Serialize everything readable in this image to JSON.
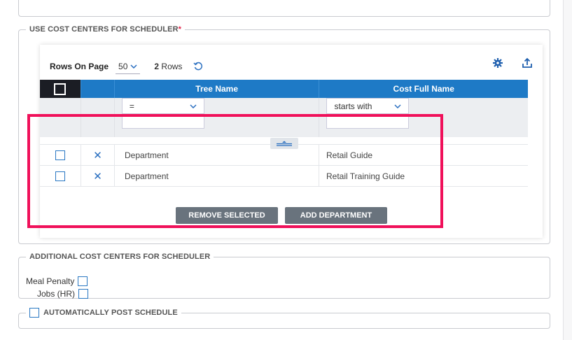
{
  "section_cost_centers": {
    "legend": "USE COST CENTERS FOR SCHEDULER",
    "required_mark": "*"
  },
  "toolbar": {
    "rows_on_page_label": "Rows On Page",
    "rows_on_page_value": "50",
    "rows_count_number": "2",
    "rows_count_text": "Rows"
  },
  "grid": {
    "columns": [
      "Tree Name",
      "Cost Full Name"
    ],
    "filters": {
      "tree_operator": "=",
      "cost_operator": "starts with"
    },
    "rows": [
      {
        "tree_name": "Department",
        "cost_full_name": "Retail Guide"
      },
      {
        "tree_name": "Department",
        "cost_full_name": "Retail Training Guide"
      }
    ]
  },
  "actions": {
    "remove_selected": "REMOVE SELECTED",
    "add_department": "ADD DEPARTMENT"
  },
  "section_additional": {
    "legend": "ADDITIONAL COST CENTERS FOR SCHEDULER",
    "options": [
      "Meal Penalty",
      "Jobs (HR)"
    ]
  },
  "section_auto_post": {
    "legend": "AUTOMATICALLY POST SCHEDULE"
  },
  "icons": {
    "settings": "gear-icon",
    "export": "upload-icon",
    "refresh": "refresh-icon",
    "remove_row": "close-icon"
  },
  "colors": {
    "header_blue": "#1e7ac6",
    "highlight": "#f0105a",
    "button_gray": "#69737d",
    "checkbox_blue": "#2a78c3"
  }
}
